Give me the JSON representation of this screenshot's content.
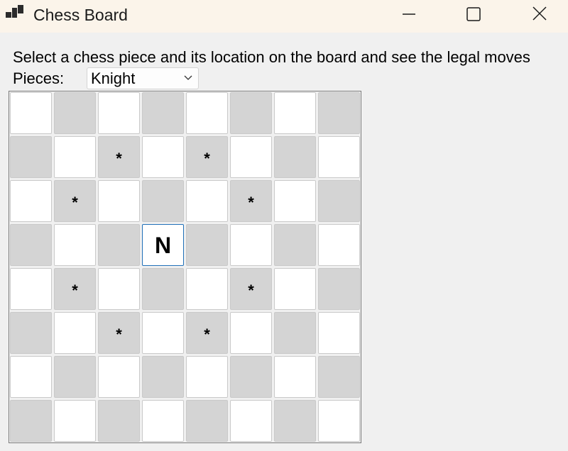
{
  "window": {
    "title": "Chess Board",
    "icon": "app-window-icon",
    "controls": [
      "minimize-icon",
      "maximize-icon",
      "close-icon"
    ]
  },
  "instruction": "Select a chess piece and its location on the board and see the legal moves",
  "pieces": {
    "label": "Pieces:",
    "selected": "Knight"
  },
  "board": {
    "light_color": "#ffffff",
    "dark_color": "#d4d4d4",
    "selected_border": "#1f6fb8",
    "rows": [
      [
        "",
        "",
        "",
        "",
        "",
        "",
        "",
        ""
      ],
      [
        "",
        "",
        "*",
        "",
        "*",
        "",
        "",
        ""
      ],
      [
        "",
        "*",
        "",
        "",
        "",
        "*",
        "",
        ""
      ],
      [
        "",
        "",
        "",
        "N",
        "",
        "",
        "",
        ""
      ],
      [
        "",
        "*",
        "",
        "",
        "",
        "*",
        "",
        ""
      ],
      [
        "",
        "",
        "*",
        "",
        "*",
        "",
        "",
        ""
      ],
      [
        "",
        "",
        "",
        "",
        "",
        "",
        "",
        ""
      ],
      [
        "",
        "",
        "",
        "",
        "",
        "",
        "",
        ""
      ]
    ]
  }
}
